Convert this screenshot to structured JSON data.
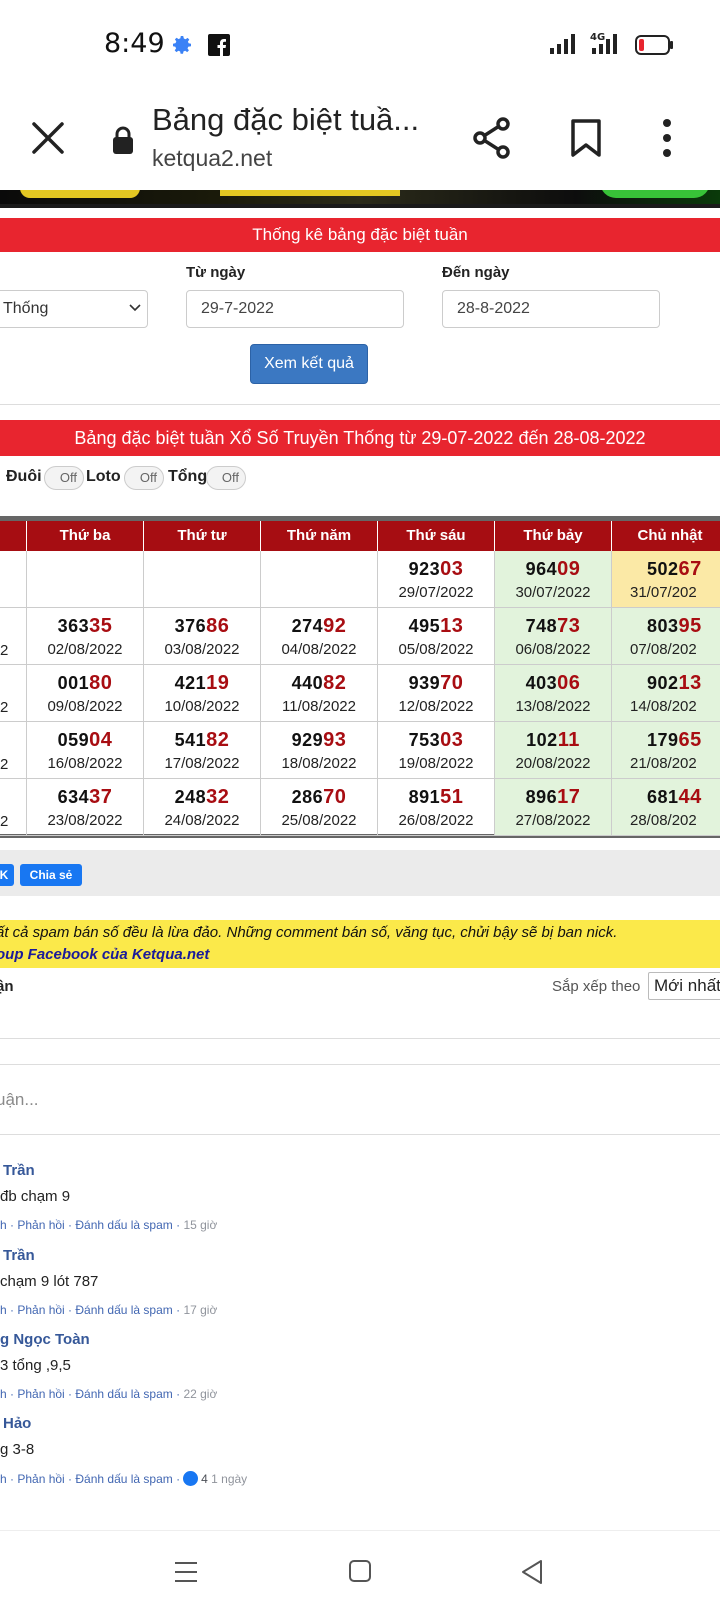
{
  "status_bar": {
    "time": "8:49",
    "network": "4G",
    "icons": [
      "settings-gear-icon",
      "facebook-icon",
      "signal-icon",
      "network-4g-icon",
      "battery-low-icon"
    ]
  },
  "browser": {
    "page_title": "Bảng đặc biệt tuầ...",
    "url": "ketqua2.net",
    "icons": [
      "close-icon",
      "lock-icon",
      "share-icon",
      "bookmark-icon",
      "more-vert-icon"
    ]
  },
  "form": {
    "heading": "Thống kê bảng đặc biệt tuần",
    "select_value": "Thống",
    "from_label": "Từ ngày",
    "from_value": "29-7-2022",
    "to_label": "Đến ngày",
    "to_value": "28-8-2022",
    "submit_label": "Xem kết quả"
  },
  "results": {
    "heading": "Bảng đặc biệt tuần Xổ Số Truyền Thống từ 29-07-2022 đến 28-08-2022",
    "toggles": [
      {
        "label": "Đuôi",
        "state": "Off"
      },
      {
        "label": "Loto",
        "state": "Off"
      },
      {
        "label": "Tổng",
        "state": "Off"
      }
    ],
    "columns": [
      "Thứ ba",
      "Thứ tư",
      "Thứ năm",
      "Thứ sáu",
      "Thứ bảy",
      "Chủ nhật"
    ],
    "partial_left": "2",
    "rows": [
      [
        null,
        null,
        null,
        {
          "head": "923",
          "tail": "03",
          "date": "29/07/2022"
        },
        {
          "head": "964",
          "tail": "09",
          "date": "30/07/2022"
        },
        {
          "head": "502",
          "tail": "67",
          "date": "31/07/202"
        }
      ],
      [
        {
          "head": "363",
          "tail": "35",
          "date": "02/08/2022"
        },
        {
          "head": "376",
          "tail": "86",
          "date": "03/08/2022"
        },
        {
          "head": "274",
          "tail": "92",
          "date": "04/08/2022"
        },
        {
          "head": "495",
          "tail": "13",
          "date": "05/08/2022"
        },
        {
          "head": "748",
          "tail": "73",
          "date": "06/08/2022"
        },
        {
          "head": "803",
          "tail": "95",
          "date": "07/08/202"
        }
      ],
      [
        {
          "head": "001",
          "tail": "80",
          "date": "09/08/2022"
        },
        {
          "head": "421",
          "tail": "19",
          "date": "10/08/2022"
        },
        {
          "head": "440",
          "tail": "82",
          "date": "11/08/2022"
        },
        {
          "head": "939",
          "tail": "70",
          "date": "12/08/2022"
        },
        {
          "head": "403",
          "tail": "06",
          "date": "13/08/2022"
        },
        {
          "head": "902",
          "tail": "13",
          "date": "14/08/202"
        }
      ],
      [
        {
          "head": "059",
          "tail": "04",
          "date": "16/08/2022"
        },
        {
          "head": "541",
          "tail": "82",
          "date": "17/08/2022"
        },
        {
          "head": "929",
          "tail": "93",
          "date": "18/08/2022"
        },
        {
          "head": "753",
          "tail": "03",
          "date": "19/08/2022"
        },
        {
          "head": "102",
          "tail": "11",
          "date": "20/08/2022"
        },
        {
          "head": "179",
          "tail": "65",
          "date": "21/08/202"
        }
      ],
      [
        {
          "head": "634",
          "tail": "37",
          "date": "23/08/2022"
        },
        {
          "head": "248",
          "tail": "32",
          "date": "24/08/2022"
        },
        {
          "head": "286",
          "tail": "70",
          "date": "25/08/2022"
        },
        {
          "head": "891",
          "tail": "51",
          "date": "26/08/2022"
        },
        {
          "head": "896",
          "tail": "17",
          "date": "27/08/2022"
        },
        {
          "head": "681",
          "tail": "44",
          "date": "28/08/202"
        }
      ]
    ]
  },
  "share": {
    "partial_button": "K",
    "share_button": "Chia sẻ"
  },
  "notice": {
    "line1": "ất cả spam bán số đều là lừa đảo. Những comment bán số, văng tục, chửi bậy sẽ bị ban nick.",
    "line2": "oup Facebook của Ketqua.net"
  },
  "comments": {
    "count_label": "ận",
    "sort_label": "Sắp xếp theo",
    "sort_value": "Mới nhất",
    "input_placeholder": "uận...",
    "items": [
      {
        "author": "Trần",
        "body": "đb chạm 9",
        "actions": "h · Phản hồi · Đánh dấu là spam ·",
        "time": "15 giờ"
      },
      {
        "author": "Trần",
        "body": "chạm 9 lót 787",
        "actions": "h · Phản hồi · Đánh dấu là spam ·",
        "time": "17 giờ"
      },
      {
        "author": "g Ngọc Toàn",
        "body": "3 tổng ,9,5",
        "actions": "h · Phản hồi · Đánh dấu là spam ·",
        "time": "22 giờ"
      },
      {
        "author": "Hảo",
        "body": "g 3-8",
        "actions": "h · Phản hồi · Đánh dấu là spam ·",
        "likes": "4",
        "time": "1 ngày"
      }
    ]
  },
  "nav": {
    "icons": [
      "recent-apps-icon",
      "home-icon",
      "back-icon"
    ]
  },
  "colors": {
    "header_red": "#e8252f",
    "table_header": "#a60d12",
    "saturday_bg": "#e2f3dc",
    "sunday_bg": "#fbe9a6",
    "notice_yellow": "#fbe94a",
    "button_blue": "#3b78c2",
    "facebook_blue": "#1877f2"
  }
}
